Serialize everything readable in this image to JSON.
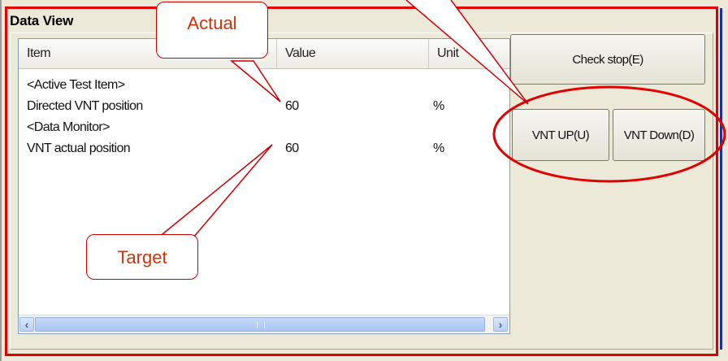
{
  "panel": {
    "title": "Data View"
  },
  "listview": {
    "columns": [
      "Item",
      "Value",
      "Unit"
    ],
    "rows": [
      {
        "item": "<Active Test Item>",
        "value": "",
        "unit": ""
      },
      {
        "item": "Directed VNT position",
        "value": "60",
        "unit": "%"
      },
      {
        "item": "<Data Monitor>",
        "value": "",
        "unit": ""
      },
      {
        "item": "VNT actual position",
        "value": "60",
        "unit": "%"
      }
    ],
    "scroll_left": "‹",
    "scroll_right": "›"
  },
  "buttons": {
    "check_stop": "Check stop(E)",
    "vnt_up": "VNT UP(U)",
    "vnt_down": "VNT Down(D)"
  },
  "annotations": {
    "actual": "Actual",
    "target": "Target"
  },
  "colors": {
    "highlight_red": "#e00000",
    "callout_text": "#d3320a"
  }
}
